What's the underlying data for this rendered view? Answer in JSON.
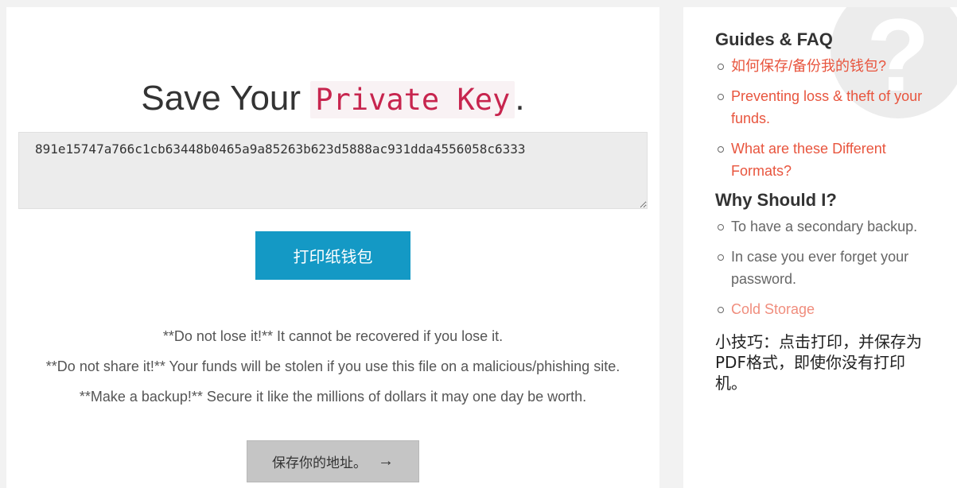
{
  "main": {
    "title_prefix": "Save Your",
    "title_code": "Private Key",
    "title_suffix": ".",
    "private_key": "891e15747a766c1cb63448b0465a9a85263b623d5888ac931dda4556058c6333",
    "print_button": "打印纸钱包",
    "warnings": [
      "**Do not lose it!** It cannot be recovered if you lose it.",
      "**Do not share it!** Your funds will be stolen if you use this file on a malicious/phishing site.",
      "**Make a backup!** Secure it like the millions of dollars it may one day be worth."
    ],
    "save_button": "保存你的地址。",
    "save_arrow": "→"
  },
  "sidebar": {
    "help_glyph": "?",
    "guides_heading": "Guides & FAQ",
    "guides_links": [
      "如何保存/备份我的钱包?",
      "Preventing loss & theft of your funds.",
      "What are these Different Formats?"
    ],
    "why_heading": "Why Should I?",
    "why_items": [
      "To have a secondary backup.",
      "In case you ever forget your password."
    ],
    "cold_storage": "Cold Storage",
    "tip": "小技巧：点击打印，并保存为PDF格式，即使你没有打印机。"
  },
  "colors": {
    "accent_blue": "#1499c5",
    "link_orange": "#e8553e",
    "code_red": "#c7254e"
  }
}
